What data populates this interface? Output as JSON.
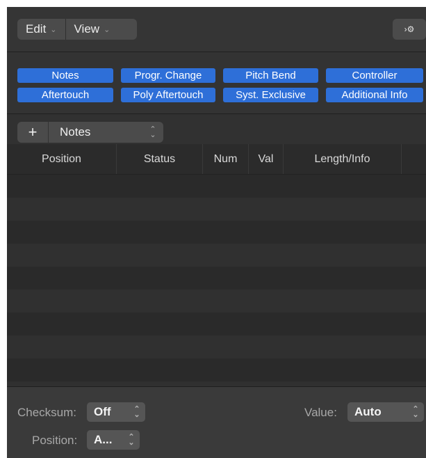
{
  "toolbar": {
    "edit_label": "Edit",
    "view_label": "View",
    "chevron_icon": "chevron-down-icon",
    "midi_icon": "midi-in-icon",
    "midi_glyph": "›⚙"
  },
  "filters": {
    "row1": [
      "Notes",
      "Progr. Change",
      "Pitch Bend",
      "Controller"
    ],
    "row2": [
      "Aftertouch",
      "Poly Aftertouch",
      "Syst. Exclusive",
      "Additional Info"
    ],
    "accent": "#2e6fd8"
  },
  "selector": {
    "plus": "+",
    "value": "Notes"
  },
  "table": {
    "columns": [
      "Position",
      "Status",
      "Num",
      "Val",
      "Length/Info"
    ],
    "rows": []
  },
  "bottom": {
    "checksum_label": "Checksum:",
    "checksum_value": "Off",
    "value_label": "Value:",
    "value_value": "Auto",
    "position_label": "Position:",
    "position_value": "A..."
  }
}
